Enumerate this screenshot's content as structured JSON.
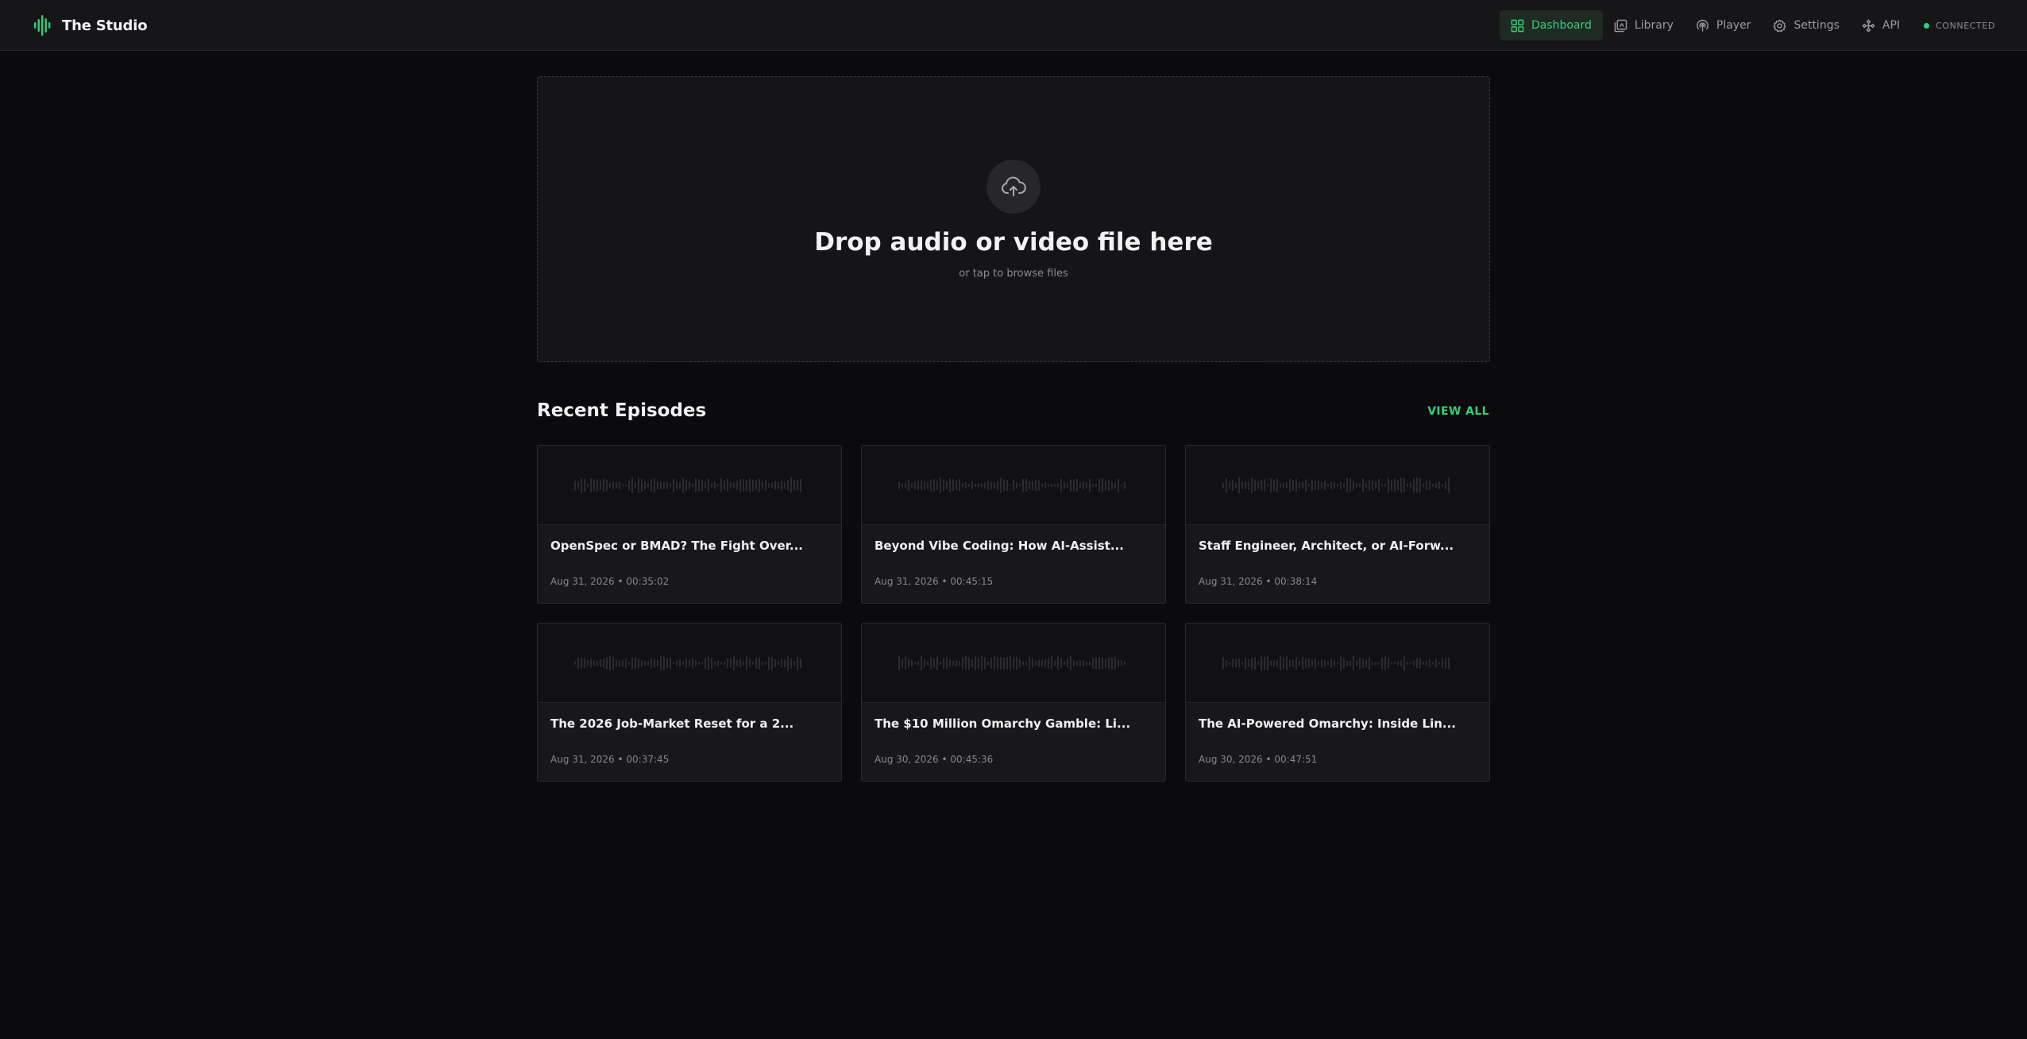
{
  "app": {
    "name": "The Studio"
  },
  "nav": {
    "items": [
      {
        "label": "Dashboard",
        "icon": "dashboard-icon",
        "active": true
      },
      {
        "label": "Library",
        "icon": "library-icon",
        "active": false
      },
      {
        "label": "Player",
        "icon": "podcast-icon",
        "active": false
      },
      {
        "label": "Settings",
        "icon": "gear-icon",
        "active": false
      },
      {
        "label": "API",
        "icon": "api-icon",
        "active": false
      }
    ],
    "status": "CONNECTED"
  },
  "dropzone": {
    "title": "Drop audio or video file here",
    "subtitle": "or tap to browse files",
    "icon": "cloud-upload-icon"
  },
  "recent": {
    "title": "Recent Episodes",
    "view_all": "VIEW ALL",
    "episodes": [
      {
        "title": "OpenSpec or BMAD? The Fight Over...",
        "meta": "Aug 31, 2026 • 00:35:02"
      },
      {
        "title": "Beyond Vibe Coding: How AI-Assist...",
        "meta": "Aug 31, 2026 • 00:45:15"
      },
      {
        "title": "Staff Engineer, Architect, or AI-Forw...",
        "meta": "Aug 31, 2026 • 00:38:14"
      },
      {
        "title": "The 2026 Job-Market Reset for a 2...",
        "meta": "Aug 31, 2026 • 00:37:45"
      },
      {
        "title": "The $10 Million Omarchy Gamble: Li...",
        "meta": "Aug 30, 2026 • 00:45:36"
      },
      {
        "title": "The AI-Powered Omarchy: Inside Lin...",
        "meta": "Aug 30, 2026 • 00:47:51"
      }
    ]
  },
  "colors": {
    "accent": "#2fd17a",
    "background": "#0b0b0d",
    "surface": "#161619"
  }
}
